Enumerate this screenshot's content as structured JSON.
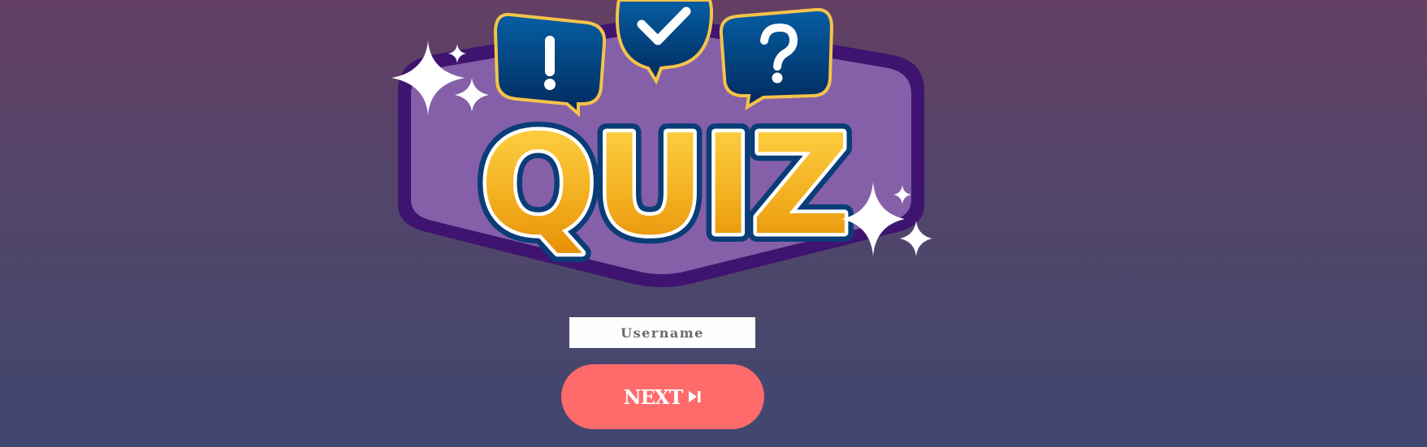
{
  "logo": {
    "text": "QUIZ",
    "bubbles": [
      {
        "glyph": "!",
        "icon": "exclamation-icon"
      },
      {
        "glyph": "",
        "icon": "checkmark-icon"
      },
      {
        "glyph": "?",
        "icon": "question-icon"
      }
    ]
  },
  "form": {
    "username_placeholder": "Username",
    "username_value": "",
    "next_label": "NEXT",
    "next_icon": "skip-forward-icon"
  },
  "colors": {
    "button": "#ff6b6b",
    "badge_fill": "#8560a8",
    "badge_border": "#3e1470",
    "bubble": "#023f7e",
    "quiz_gold": "#f3b122"
  }
}
